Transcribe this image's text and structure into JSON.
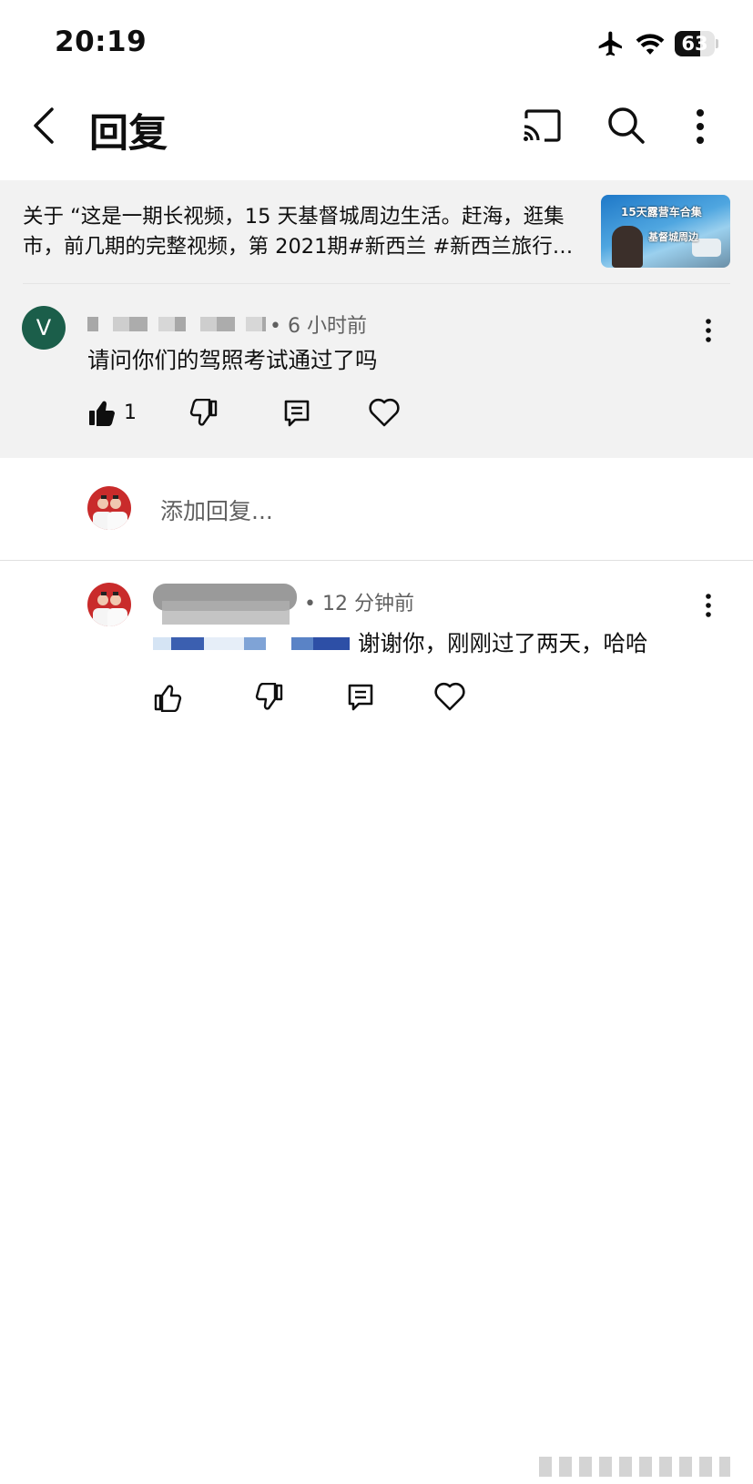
{
  "status_bar": {
    "time": "20:19",
    "battery": "63",
    "battery_level": 0.63
  },
  "header": {
    "title": "回复"
  },
  "icons": [
    "back-icon",
    "cast-icon",
    "search-icon",
    "more-vert-icon",
    "airplane-icon",
    "wifi-icon",
    "thumb-up-icon",
    "thumb-down-icon",
    "reply-icon",
    "heart-icon"
  ],
  "context": {
    "line1": "关于 “这是一期长视频，15 天基督城周边生活。赶海，逛集",
    "line2": "市，前几期的完整视频，第 2021期#新西兰 #新西兰旅行…",
    "thumbnail_caption1": "15天露营车合集",
    "thumbnail_caption2": "基督城周边"
  },
  "parent_comment": {
    "avatar_letter": "V",
    "time": "• 6 小时前",
    "text": "请问你们的驾照考试通过了吗",
    "like_count": "1"
  },
  "add_reply": {
    "placeholder": "添加回复..."
  },
  "reply": {
    "time": "• 12 分钟前",
    "text": "谢谢你，刚刚过了两天，哈哈"
  },
  "colors": {
    "avatar_v": "#1b5e4a",
    "banner_bg": "#f2f2f2",
    "meta_text": "#606060"
  }
}
